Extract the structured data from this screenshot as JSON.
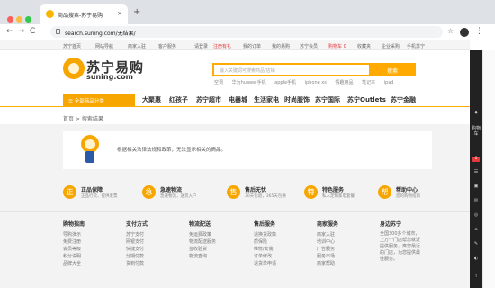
{
  "browser": {
    "tab_title": "商品搜索-苏宁易购",
    "tab_close": "×",
    "new_tab": "+",
    "back": "←",
    "forward": "→",
    "reload": "C",
    "home": "⌂",
    "url": "search.suning.com/无结果/",
    "star": "☆",
    "menu": "⋮",
    "colors": {
      "close": "#fc605c",
      "min": "#fdbc40",
      "max": "#34c84a"
    }
  },
  "topbar": {
    "home": "苏宁首页",
    "nav1": "网站导航",
    "nav2": "商家入驻",
    "nav3": "客户服务",
    "login": "请登录",
    "register": "注册有礼",
    "orders": "我的订单",
    "mine": "我的易购",
    "member": "苏宁会员",
    "cart": "购物车 0",
    "bookmark": "收藏夹",
    "enterprise": "企业采购",
    "mobile": "手机苏宁"
  },
  "header": {
    "logo_cn": "苏宁易购",
    "logo_en": "suning.com",
    "search_placeholder": "输入关键词可搜索商品/店铺",
    "search_button": "搜索",
    "hot": [
      "空调",
      "华为huawei手机",
      "apple手机",
      "iphone xs",
      "情趣用品",
      "笔记本",
      "ipad"
    ]
  },
  "nav": {
    "all": "全部商品分类",
    "items": [
      "大聚惠",
      "红孩子",
      "苏宁超市",
      "电器城",
      "生活家电",
      "时尚服饰",
      "苏宁国际",
      "苏宁Outlets",
      "苏宁金融"
    ]
  },
  "breadcrumb": "首页 > 搜索结果",
  "noresult": "根据相关法律法规和政策，无法显示相关的商品。",
  "services": [
    {
      "icon": "正",
      "title": "正品保障",
      "desc": "正品行货，提供发票"
    },
    {
      "icon": "急",
      "title": "急速物流",
      "desc": "急速物流，送货入户"
    },
    {
      "icon": "售",
      "title": "售后无忧",
      "desc": "30天包退，365天包换"
    },
    {
      "icon": "特",
      "title": "特色服务",
      "desc": "私人定制家电套餐"
    },
    {
      "icon": "帮",
      "title": "帮助中心",
      "desc": "您的购物指南"
    }
  ],
  "footer": [
    {
      "title": "购物指南",
      "links": [
        "导购演示",
        "免费注册",
        "会员等级",
        "积分说明",
        "品牌大全"
      ]
    },
    {
      "title": "支付方式",
      "links": [
        "苏宁支付",
        "网银支付",
        "快捷支付",
        "分期付款",
        "货到付款"
      ]
    },
    {
      "title": "物流配送",
      "links": [
        "免运费政策",
        "物流配送服务",
        "签收验货",
        "物流查询",
        ""
      ]
    },
    {
      "title": "售后服务",
      "links": [
        "退换货政策",
        "质保险",
        "维修/安装",
        "订单修改",
        "退货单申请"
      ]
    },
    {
      "title": "商家服务",
      "links": [
        "商家入驻",
        "培训中心",
        "广告服务",
        "服务市场",
        "商家帮助"
      ]
    },
    {
      "title": "身边苏宁",
      "paragraph": "全国300多个城市，上万个门店帮您就近提供服务，离您最近的门店，为您提供最佳服务。"
    }
  ],
  "sidebar": {
    "cart_label": "购物车",
    "cart_count": "0",
    "icons": [
      "◆",
      "☰",
      "▣",
      "✉",
      "◎",
      "⌂",
      "✎",
      "◐",
      "↑"
    ]
  }
}
